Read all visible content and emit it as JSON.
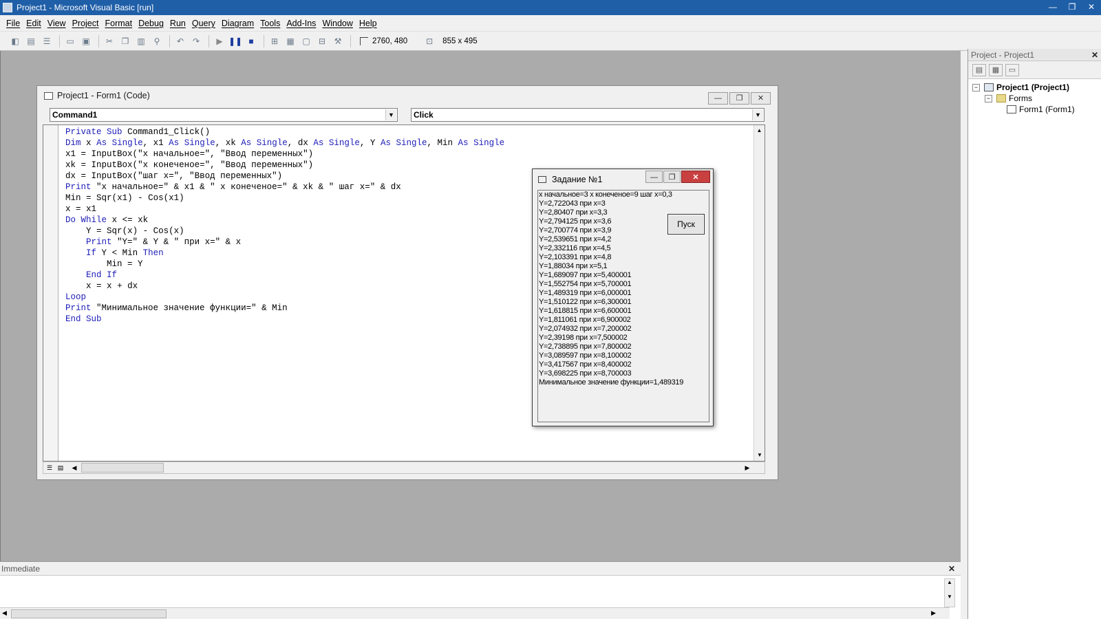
{
  "app": {
    "title": "Project1 - Microsoft Visual Basic [run]",
    "window_buttons": [
      "—",
      "❐",
      "✕"
    ]
  },
  "menu": [
    "File",
    "Edit",
    "View",
    "Project",
    "Format",
    "Debug",
    "Run",
    "Query",
    "Diagram",
    "Tools",
    "Add-Ins",
    "Window",
    "Help"
  ],
  "toolbar": {
    "position_text": "2760, 480",
    "size_text": "855 x 495"
  },
  "code_window": {
    "title": "Project1 - Form1 (Code)",
    "object_combo": "Command1",
    "procedure_combo": "Click",
    "lines": [
      "Private Sub Command1_Click()",
      "Dim x As Single, x1 As Single, xk As Single, dx As Single, Y As Single, Min As Single",
      "x1 = InputBox(\"x начальное=\", \"Ввод переменных\")",
      "xk = InputBox(\"x конеченое=\", \"Ввод переменных\")",
      "dx = InputBox(\"шаг x=\", \"Ввод переменных\")",
      "Print \"x начальное=\" & x1 & \" x конеченое=\" & xk & \" шаг x=\" & dx",
      "Min = Sqr(x1) - Cos(x1)",
      "x = x1",
      "Do While x <= xk",
      "    Y = Sqr(x) - Cos(x)",
      "    Print \"Y=\" & Y & \" при x=\" & x",
      "    If Y < Min Then",
      "        Min = Y",
      "    End If",
      "    x = x + dx",
      "Loop",
      "Print \"Минимальное значение функции=\" & Min",
      "End Sub"
    ]
  },
  "form_window": {
    "title": "Задание №1",
    "button_label": "Пуск",
    "output": [
      "x начальное=3 x конеченое=9 шаг x=0,3",
      "Y=2,722043 при x=3",
      "Y=2,80407 при x=3,3",
      "Y=2,794125 при x=3,6",
      "Y=2,700774 при x=3,9",
      "Y=2,539651 при x=4,2",
      "Y=2,332116 при x=4,5",
      "Y=2,103391 при x=4,8",
      "Y=1,88034 при x=5,1",
      "Y=1,689097 при x=5,400001",
      "Y=1,552754 при x=5,700001",
      "Y=1,489319 при x=6,000001",
      "Y=1,510122 при x=6,300001",
      "Y=1,618815 при x=6,600001",
      "Y=1,811061 при x=6,900002",
      "Y=2,074932 при x=7,200002",
      "Y=2,39198 при x=7,500002",
      "Y=2,738895 при x=7,800002",
      "Y=3,089597 при x=8,100002",
      "Y=3,417567 при x=8,400002",
      "Y=3,698225 при x=8,700003",
      "Минимальное значение функции=1,489319"
    ]
  },
  "project_explorer": {
    "title": "Project - Project1",
    "root": "Project1 (Project1)",
    "folder": "Forms",
    "item": "Form1 (Form1)"
  },
  "immediate": {
    "title": "Immediate"
  },
  "colors": {
    "titlebar": "#1f5fa8",
    "keyword": "#1c1cb8",
    "mdi_background": "#ababab"
  }
}
